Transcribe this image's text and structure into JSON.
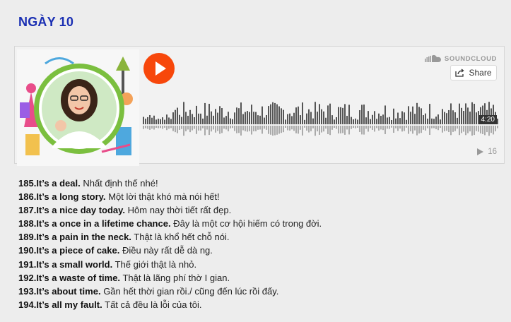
{
  "page": {
    "heading": "NGÀY 10"
  },
  "player": {
    "brand": "SOUNDCLOUD",
    "share_label": "Share",
    "duration": "4:20",
    "play_count": "16",
    "colors": {
      "play": "#f7470b",
      "wave": "#555555"
    }
  },
  "phrases": [
    {
      "num": "185.",
      "en": "It’s a deal.",
      "vi": "Nhất định thế nhé!"
    },
    {
      "num": "186.",
      "en": "It’s a long story.",
      "vi": "Một lời thật khó mà nói hết!"
    },
    {
      "num": "187.",
      "en": "It’s a nice day today.",
      "vi": "Hôm nay thời tiết rất đẹp."
    },
    {
      "num": "188.",
      "en": "It’s a once in a lifetime chance.",
      "vi": "Đây là một cơ hội hiếm có trong đời."
    },
    {
      "num": "189.",
      "en": "It’s a pain in the neck.",
      "vi": "Thật là khổ hết chỗ nói."
    },
    {
      "num": "190.",
      "en": "It’s a piece of cake.",
      "vi": "Điều này rất dễ dà ng."
    },
    {
      "num": "191.",
      "en": "It’s a small world.",
      "vi": "Thế giới thật là nhỏ."
    },
    {
      "num": "192.",
      "en": "It’s a waste of time.",
      "vi": "Thật là lãng phí thờ I gian."
    },
    {
      "num": "193.",
      "en": "It’s about time.",
      "vi": "Gần hết thời gian rồi./ cũng đến lúc rồi đấy."
    },
    {
      "num": "194.",
      "en": "It’s all my fault.",
      "vi": "Tất cả đều là lỗi của tôi."
    }
  ]
}
